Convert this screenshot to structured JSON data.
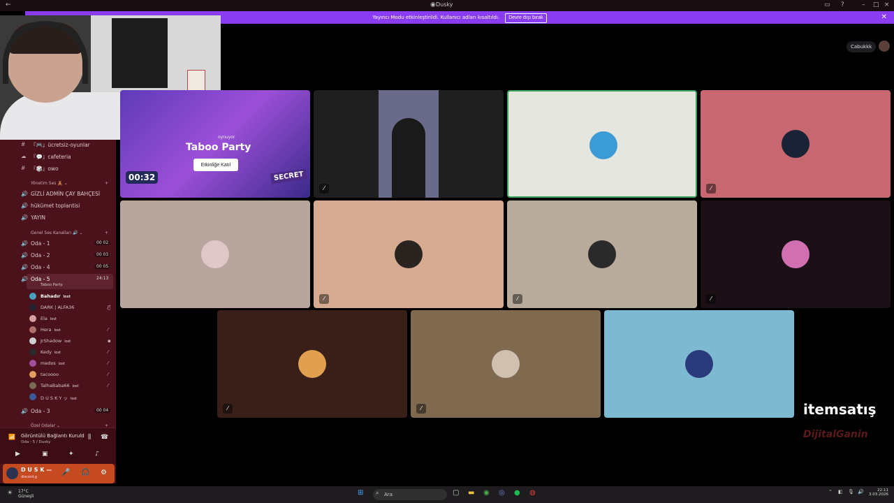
{
  "app": {
    "title": "Dusky"
  },
  "banner": {
    "text": "Yayıncı Modu etkinleştirildi. Kullanıcı adları kısaltıldı.",
    "button": "Devre dışı bırak"
  },
  "channels": [
    {
      "label": "『🎮』ücretsiz-oyunlar"
    },
    {
      "label": "『💬』cafeteria"
    },
    {
      "label": "『🎲』owo"
    }
  ],
  "categories": {
    "yonetim": "Yönetim Ses 🧸",
    "genel": "Genel Ses Kanalları 🔊",
    "ozel": "Özel Odalar"
  },
  "yonetim_rooms": [
    {
      "label": "GİZLİ ADMİN ÇAY BAHÇESİ"
    },
    {
      "label": "hükümet toplantisi"
    },
    {
      "label": "YAYIN"
    }
  ],
  "genel_rooms": [
    {
      "label": "Oda - 1",
      "count": "00 02"
    },
    {
      "label": "Oda - 2",
      "count": "00 03"
    },
    {
      "label": "Oda - 4",
      "count": "00 05"
    }
  ],
  "active_room": {
    "label": "Oda - 5",
    "timer": "24:13",
    "activity": "Taboo Party"
  },
  "members": [
    {
      "name": "Bahadır",
      "tag": "lost",
      "color": "#4aa0c0"
    },
    {
      "name": "DARK | ALFA36",
      "tag": "",
      "color": "#223"
    },
    {
      "name": "Ela",
      "tag": "lost",
      "color": "#d8a0a0"
    },
    {
      "name": "Hera",
      "tag": "lost",
      "color": "#b07070"
    },
    {
      "name": "JrShadow",
      "tag": "lost",
      "color": "#d0d0d0"
    },
    {
      "name": "Kedy",
      "tag": "lost",
      "color": "#2a2a2a"
    },
    {
      "name": "medos",
      "tag": "lost",
      "color": "#a050a0"
    },
    {
      "name": "tacoooo",
      "tag": "",
      "color": "#e0a060"
    },
    {
      "name": "TalhaBaba66",
      "tag": "lost",
      "color": "#7a6a58"
    },
    {
      "name": "D U S K Y ッ",
      "tag": "lost",
      "color": "#3a5a9a"
    }
  ],
  "last_room": {
    "label": "Oda - 3",
    "count": "00 04"
  },
  "connection": {
    "label": "Görüntülü Bağlantı Kuruld",
    "sub": "Oda - 5 / Dusky"
  },
  "user": {
    "name": "D U S K —",
    "status": "discord.g"
  },
  "activity": {
    "title": "Taboo Party",
    "playing": "oynuyor",
    "join": "Etkinliğe Katıl",
    "timer": "00:32",
    "secret": "SECRET"
  },
  "streamer": {
    "name": "Cabukkk"
  },
  "tiles": [
    {
      "bg": "#1f1f1f",
      "avatar": "#111"
    },
    {
      "bg": "#e5e6de",
      "avatar": "#3a9bd6"
    },
    {
      "bg": "#c7676f",
      "avatar": "#1a2236"
    },
    {
      "bg": "#b8a69e",
      "avatar": "#e0c8c8"
    },
    {
      "bg": "#d6ab92",
      "avatar": "#2a2420"
    },
    {
      "bg": "#b8ab9c",
      "avatar": "#2a2a2a"
    },
    {
      "bg": "#1c1016",
      "avatar": "#d070b0"
    },
    {
      "bg": "#3a1f18",
      "avatar": "#e0a050"
    },
    {
      "bg": "#7f6a4f",
      "avatar": "#d0c0b0"
    },
    {
      "bg": "#7db9d0",
      "avatar": "#2a3a7a"
    }
  ],
  "brands": {
    "primary": "itemsatış",
    "secondary": "DijitalGanin"
  },
  "taskbar": {
    "temp": "17°C",
    "weather": "Güneşli",
    "search": "Ara",
    "time": "22:11",
    "date": "3.03.2026"
  }
}
